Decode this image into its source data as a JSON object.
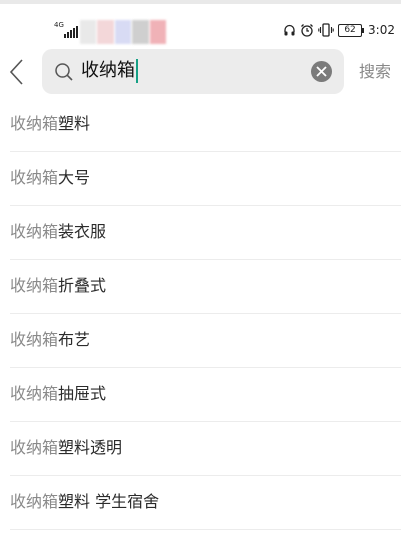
{
  "status_bar": {
    "network": "4G",
    "battery": "62",
    "time": "3:02",
    "icons": [
      "headphones-icon",
      "alarm-icon",
      "vibrate-icon",
      "battery-icon"
    ]
  },
  "search": {
    "back_icon": "chevron-left-icon",
    "search_icon": "magnifier-icon",
    "query": "收纳箱",
    "clear_icon": "clear-icon",
    "submit_label": "搜索"
  },
  "suggestions": [
    {
      "prefix": "收纳箱",
      "suffix": "塑料"
    },
    {
      "prefix": "收纳箱",
      "suffix": "大号"
    },
    {
      "prefix": "收纳箱",
      "suffix": "装衣服"
    },
    {
      "prefix": "收纳箱",
      "suffix": "折叠式"
    },
    {
      "prefix": "收纳箱",
      "suffix": "布艺"
    },
    {
      "prefix": "收纳箱",
      "suffix": "抽屉式"
    },
    {
      "prefix": "收纳箱",
      "suffix": "塑料透明"
    },
    {
      "prefix": "收纳箱",
      "suffix": "塑料 学生宿舍"
    }
  ],
  "colors": {
    "caret": "#16a085",
    "search_bg": "#ececec",
    "prefix_text": "#8a8a8a",
    "suffix_text": "#2b2b2b"
  }
}
